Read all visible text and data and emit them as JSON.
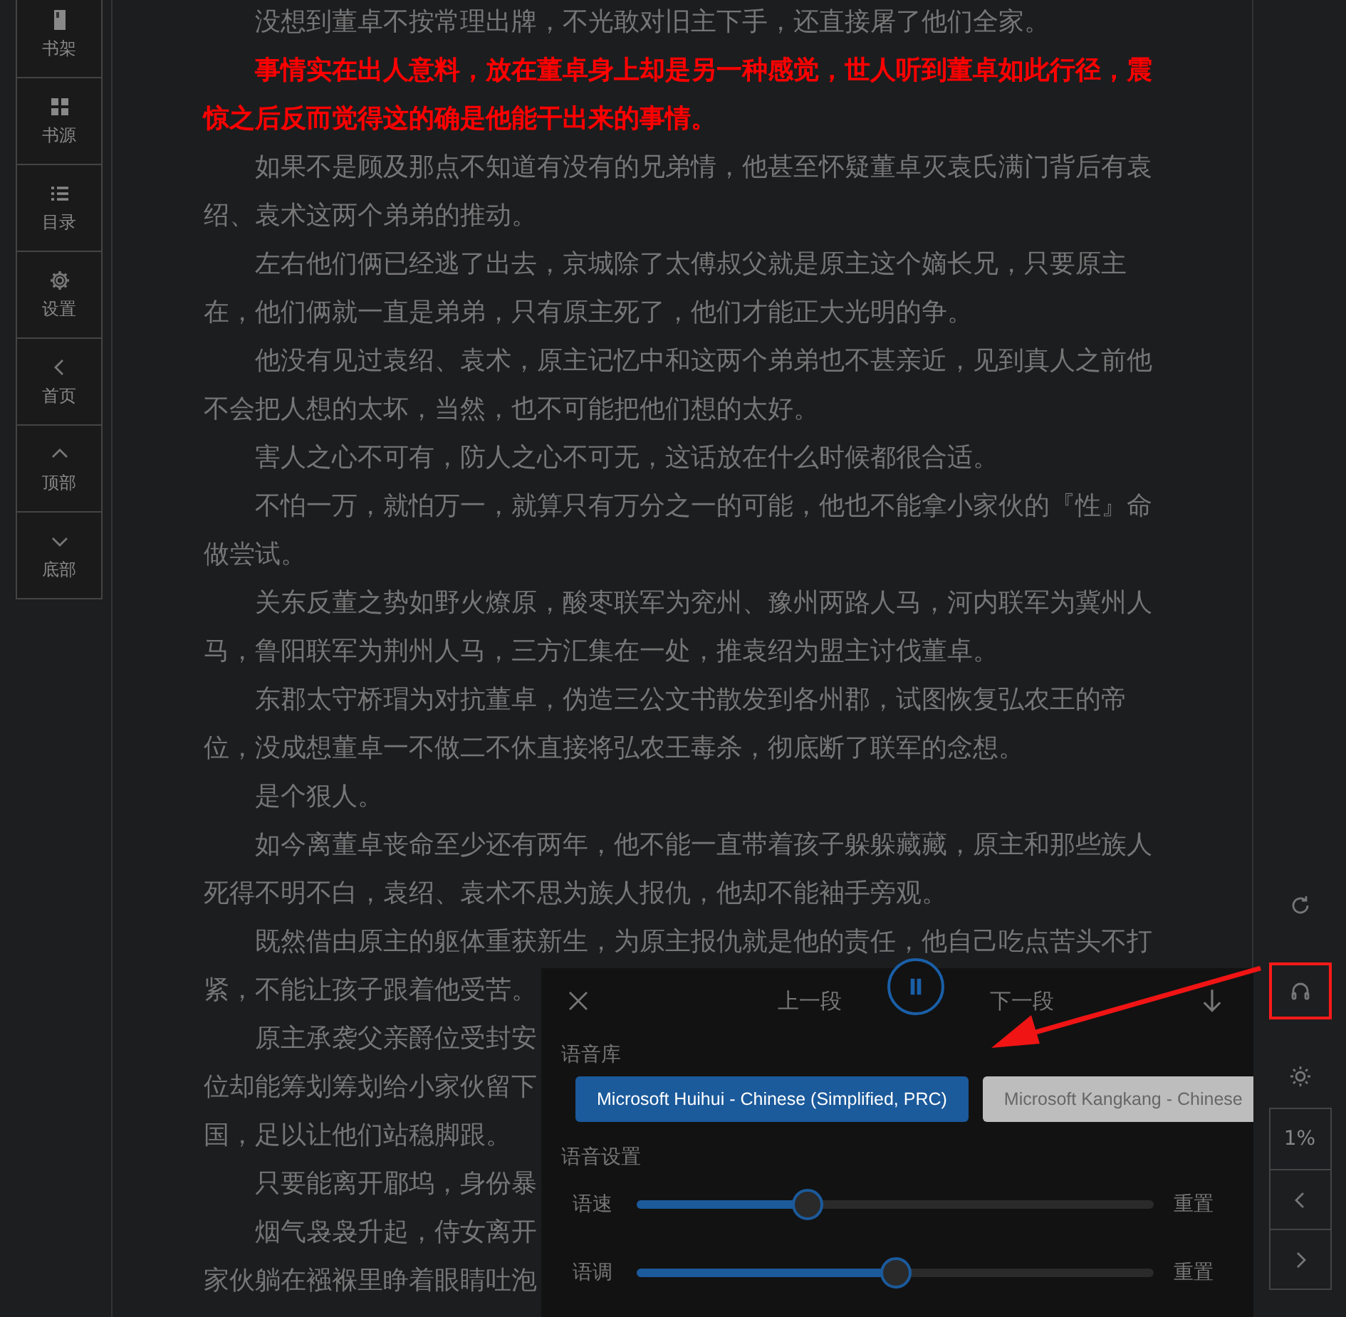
{
  "sidebar": {
    "items": [
      {
        "label": "书架"
      },
      {
        "label": "书源"
      },
      {
        "label": "目录"
      },
      {
        "label": "设置"
      },
      {
        "label": "首页"
      },
      {
        "label": "顶部"
      },
      {
        "label": "底部"
      }
    ]
  },
  "paragraphs": [
    {
      "kind": "normal",
      "text": "没想到董卓不按常理出牌，不光敢对旧主下手，还直接屠了他们全家。"
    },
    {
      "kind": "highlight",
      "text": "事情实在出人意料，放在董卓身上却是另一种感觉，世人听到董卓如此行径，震惊之后反而觉得这的确是他能干出来的事情。"
    },
    {
      "kind": "normal",
      "text": "如果不是顾及那点不知道有没有的兄弟情，他甚至怀疑董卓灭袁氏满门背后有袁绍、袁术这两个弟弟的推动。"
    },
    {
      "kind": "normal",
      "text": "左右他们俩已经逃了出去，京城除了太傅叔父就是原主这个嫡长兄，只要原主在，他们俩就一直是弟弟，只有原主死了，他们才能正大光明的争。"
    },
    {
      "kind": "normal",
      "text": "他没有见过袁绍、袁术，原主记忆中和这两个弟弟也不甚亲近，见到真人之前他不会把人想的太坏，当然，也不可能把他们想的太好。"
    },
    {
      "kind": "normal",
      "text": "害人之心不可有，防人之心不可无，这话放在什么时候都很合适。"
    },
    {
      "kind": "normal",
      "text": "不怕一万，就怕万一，就算只有万分之一的可能，他也不能拿小家伙的『性』命做尝试。"
    },
    {
      "kind": "normal",
      "text": "关东反董之势如野火燎原，酸枣联军为兖州、豫州两路人马，河内联军为冀州人马，鲁阳联军为荆州人马，三方汇集在一处，推袁绍为盟主讨伐董卓。"
    },
    {
      "kind": "normal",
      "text": "东郡太守桥瑁为对抗董卓，伪造三公文书散发到各州郡，试图恢复弘农王的帝位，没成想董卓一不做二不休直接将弘农王毒杀，彻底断了联军的念想。"
    },
    {
      "kind": "normal",
      "text": "是个狠人。"
    },
    {
      "kind": "normal",
      "text": "如今离董卓丧命至少还有两年，他不能一直带着孩子躲躲藏藏，原主和那些族人死得不明不白，袁绍、袁术不思为族人报仇，他却不能袖手旁观。"
    },
    {
      "kind": "partial",
      "lines": [
        "既然借由原主的躯体重获新生，为原主报仇就是他的责任，他自己吃点苦头不打",
        "紧，不能让孩子跟着他受苦。"
      ]
    },
    {
      "kind": "partial",
      "lines": [
        "原主承袭父亲爵位受封安",
        "位却能筹划筹划给小家伙留下",
        "国，足以让他们站稳脚跟。"
      ]
    },
    {
      "kind": "partial",
      "lines": [
        "只要能离开郿坞，身份暴"
      ]
    },
    {
      "kind": "partial",
      "lines": [
        "烟气袅袅升起，侍女离开",
        "家伙躺在襁褓里睁着眼睛吐泡"
      ]
    }
  ],
  "tts_panel": {
    "playing": true,
    "prev": "上一段",
    "next": "下一段",
    "voice_library_label": "语音库",
    "voices": [
      {
        "name": "Microsoft Huihui - Chinese (Simplified, PRC)",
        "selected": true
      },
      {
        "name": "Microsoft Kangkang - Chinese",
        "selected": false
      }
    ],
    "settings_label": "语音设置",
    "sliders": [
      {
        "label": "语速",
        "level": 0.33,
        "reset": "重置"
      },
      {
        "label": "语调",
        "level": 0.5,
        "reset": "重置"
      }
    ]
  },
  "right_toolbar": {
    "buttons": [
      {
        "highlighted": false
      },
      {
        "highlighted": true
      },
      {
        "highlighted": false
      }
    ],
    "progress": "1%"
  }
}
